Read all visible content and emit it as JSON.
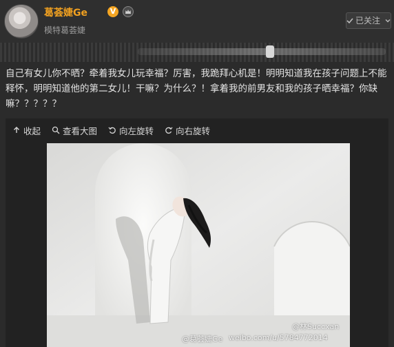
{
  "header": {
    "username": "葛荟婕Ge",
    "verified_badge": "V",
    "subtitle": "模特葛荟婕",
    "follow_label": "已关注",
    "colors": {
      "username": "#f0a020",
      "verified": "#f5a623"
    },
    "icons": [
      "avatar",
      "verified-icon",
      "crown-icon",
      "check-icon",
      "chevron-down-icon"
    ]
  },
  "post": {
    "text": "自己有女儿你不晒？牵着我女儿玩幸福？厉害，我跪拜心机是！明明知道我在孩子问题上不能释怀，明明知道他的第二女儿！干嘛？为什么？！拿着我的前男友和我的孩子晒幸福？你缺嘛？？？？？"
  },
  "toolbar": {
    "collapse": "收起",
    "view_large": "查看大图",
    "rotate_left": "向左旋转",
    "rotate_right": "向右旋转",
    "icons": [
      "arrow-up-icon",
      "search-icon",
      "rotate-left-icon",
      "rotate-right-icon"
    ]
  },
  "photo": {
    "watermark_left": "@葛荟婕Ge",
    "watermark_url": "weibo.com/u/5784772014",
    "watermark_right": "@林Succxan"
  }
}
